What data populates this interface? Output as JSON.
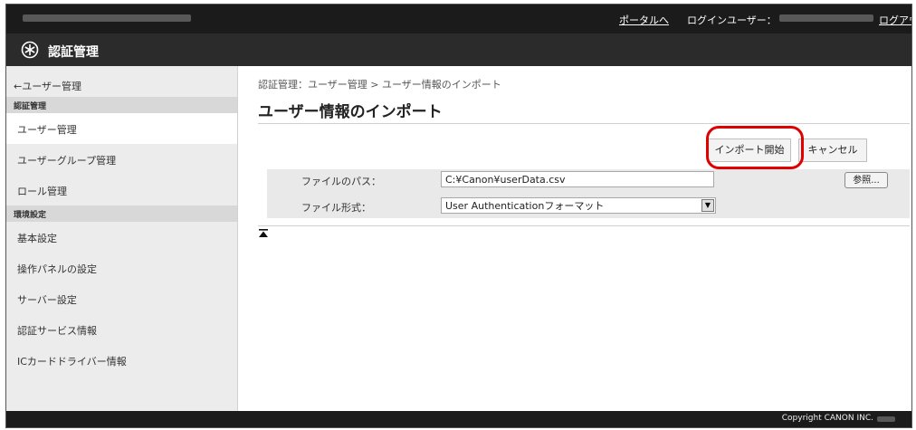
{
  "topbar": {
    "portal_link": "ポータルへ",
    "login_user_label": "ログインユーザー：",
    "logout_link": "ログアウト"
  },
  "app": {
    "title": "認証管理"
  },
  "sidebar": {
    "back_link": "←ユーザー管理",
    "sections": [
      {
        "heading": "認証管理",
        "items": [
          {
            "label": "ユーザー管理",
            "active": true
          },
          {
            "label": "ユーザーグループ管理",
            "active": false
          },
          {
            "label": "ロール管理",
            "active": false
          }
        ]
      },
      {
        "heading": "環境設定",
        "items": [
          {
            "label": "基本設定",
            "active": false
          },
          {
            "label": "操作パネルの設定",
            "active": false
          },
          {
            "label": "サーバー設定",
            "active": false
          },
          {
            "label": "認証サービス情報",
            "active": false
          },
          {
            "label": "ICカードドライバー情報",
            "active": false
          }
        ]
      }
    ]
  },
  "main": {
    "breadcrumb": "認証管理：ユーザー管理 > ユーザー情報のインポート",
    "page_title": "ユーザー情報のインポート",
    "buttons": {
      "import_start": "インポート開始",
      "cancel": "キャンセル"
    },
    "form": {
      "file_path_label": "ファイルのパス：",
      "file_path_value": "C:¥Canon¥userData.csv",
      "browse_button": "参照...",
      "file_format_label": "ファイル形式：",
      "file_format_value": "User Authenticationフォーマット"
    }
  },
  "footer": {
    "copyright": "Copyright CANON INC."
  },
  "colors": {
    "topbar_bg": "#1b1b1b",
    "appbar_bg": "#2b2b2b",
    "sidebar_bg": "#ececec",
    "highlight_ring": "#e00000"
  },
  "icons": {
    "app_icon": "authentication-logo-icon",
    "select_arrow": "chevron-down-icon",
    "page_top": "arrow-to-top-icon"
  }
}
